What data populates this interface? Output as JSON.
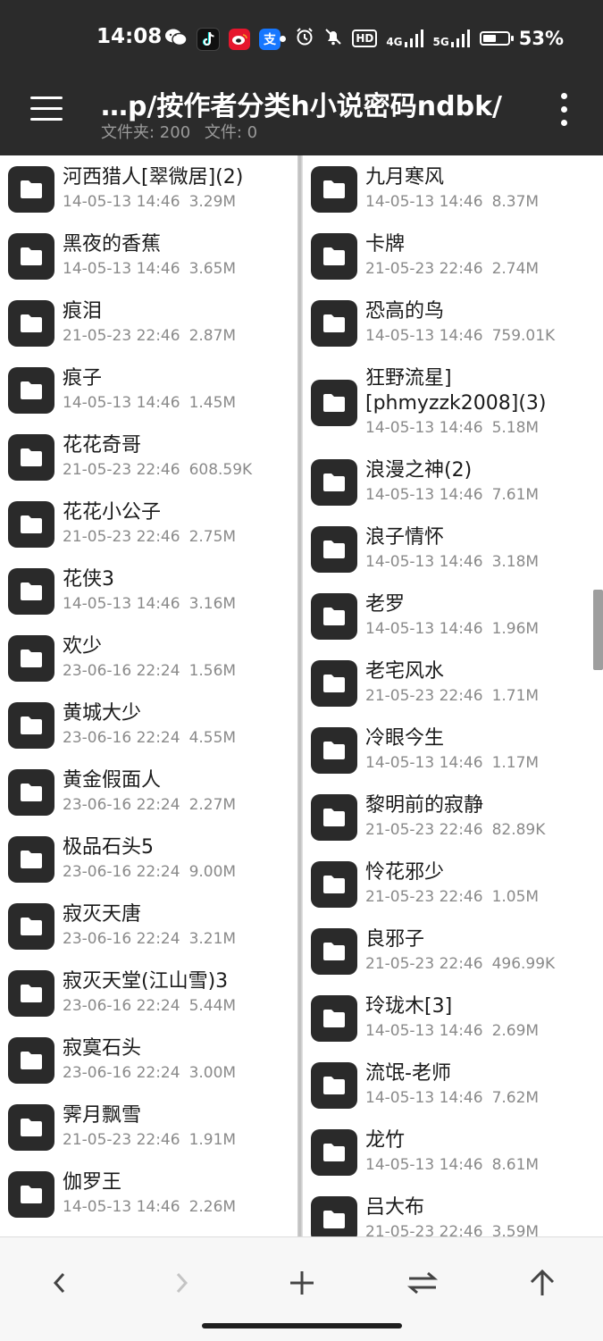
{
  "status_bar": {
    "time": "14:08",
    "app_icons": [
      "wechat-icon",
      "tiktok-icon",
      "weibo-icon",
      "alipay-icon"
    ],
    "alipay_glyph": "支",
    "hd_label": "HD",
    "net1": "4G",
    "net2": "5G",
    "battery_percent": "53%",
    "battery_level": 0.53
  },
  "app_bar": {
    "title": "…p/按作者分类h小说密码ndbk/",
    "folders_label": "文件夹: 200",
    "files_label": "文件: 0"
  },
  "left_pane": {
    "items": [
      {
        "name": "河西猎人[翠微居](2)",
        "date": "14-05-13 14:46",
        "size": "3.29M"
      },
      {
        "name": "黑夜的香蕉",
        "date": "14-05-13 14:46",
        "size": "3.65M"
      },
      {
        "name": "痕泪",
        "date": "21-05-23 22:46",
        "size": "2.87M"
      },
      {
        "name": "痕子",
        "date": "14-05-13 14:46",
        "size": "1.45M"
      },
      {
        "name": "花花奇哥",
        "date": "21-05-23 22:46",
        "size": "608.59K"
      },
      {
        "name": "花花小公子",
        "date": "21-05-23 22:46",
        "size": "2.75M"
      },
      {
        "name": "花侠3",
        "date": "14-05-13 14:46",
        "size": "3.16M"
      },
      {
        "name": "欢少",
        "date": "23-06-16 22:24",
        "size": "1.56M"
      },
      {
        "name": "黄城大少",
        "date": "23-06-16 22:24",
        "size": "4.55M"
      },
      {
        "name": "黄金假面人",
        "date": "23-06-16 22:24",
        "size": "2.27M"
      },
      {
        "name": "极品石头5",
        "date": "23-06-16 22:24",
        "size": "9.00M"
      },
      {
        "name": "寂灭天唐",
        "date": "23-06-16 22:24",
        "size": "3.21M"
      },
      {
        "name": "寂灭天堂(江山雪)3",
        "date": "23-06-16 22:24",
        "size": "5.44M"
      },
      {
        "name": "寂寞石头",
        "date": "23-06-16 22:24",
        "size": "3.00M"
      },
      {
        "name": "霁月飘雪",
        "date": "21-05-23 22:46",
        "size": "1.91M"
      },
      {
        "name": "伽罗王",
        "date": "14-05-13 14:46",
        "size": "2.26M"
      }
    ]
  },
  "right_pane": {
    "items": [
      {
        "name": "九月寒风",
        "date": "14-05-13 14:46",
        "size": "8.37M"
      },
      {
        "name": "卡牌",
        "date": "21-05-23 22:46",
        "size": "2.74M"
      },
      {
        "name": "恐高的鸟",
        "date": "14-05-13 14:46",
        "size": "759.01K"
      },
      {
        "name": "狂野流星]",
        "name2": "[phmyzzk2008](3)",
        "date": "14-05-13 14:46",
        "size": "5.18M"
      },
      {
        "name": "浪漫之神(2)",
        "date": "14-05-13 14:46",
        "size": "7.61M"
      },
      {
        "name": "浪子情怀",
        "date": "14-05-13 14:46",
        "size": "3.18M"
      },
      {
        "name": "老罗",
        "date": "14-05-13 14:46",
        "size": "1.96M"
      },
      {
        "name": "老宅风水",
        "date": "21-05-23 22:46",
        "size": "1.71M"
      },
      {
        "name": "冷眼今生",
        "date": "14-05-13 14:46",
        "size": "1.17M"
      },
      {
        "name": "黎明前的寂静",
        "date": "21-05-23 22:46",
        "size": "82.89K"
      },
      {
        "name": "怜花邪少",
        "date": "21-05-23 22:46",
        "size": "1.05M"
      },
      {
        "name": "良邪子",
        "date": "21-05-23 22:46",
        "size": "496.99K"
      },
      {
        "name": "玲珑木[3]",
        "date": "14-05-13 14:46",
        "size": "2.69M"
      },
      {
        "name": "流氓-老师",
        "date": "14-05-13 14:46",
        "size": "7.62M"
      },
      {
        "name": "龙竹",
        "date": "14-05-13 14:46",
        "size": "8.61M"
      },
      {
        "name": "吕大布",
        "date": "21-05-23 22:46",
        "size": "3.59M"
      }
    ]
  },
  "bottom_bar": {
    "buttons": [
      "back-icon",
      "forward-icon",
      "add-icon",
      "swap-panes-icon",
      "up-directory-icon"
    ]
  },
  "colors": {
    "app_bar_bg": "#2b2b2b",
    "folder_icon_bg": "#2a2a2a",
    "meta_text": "#8a8a8a"
  }
}
